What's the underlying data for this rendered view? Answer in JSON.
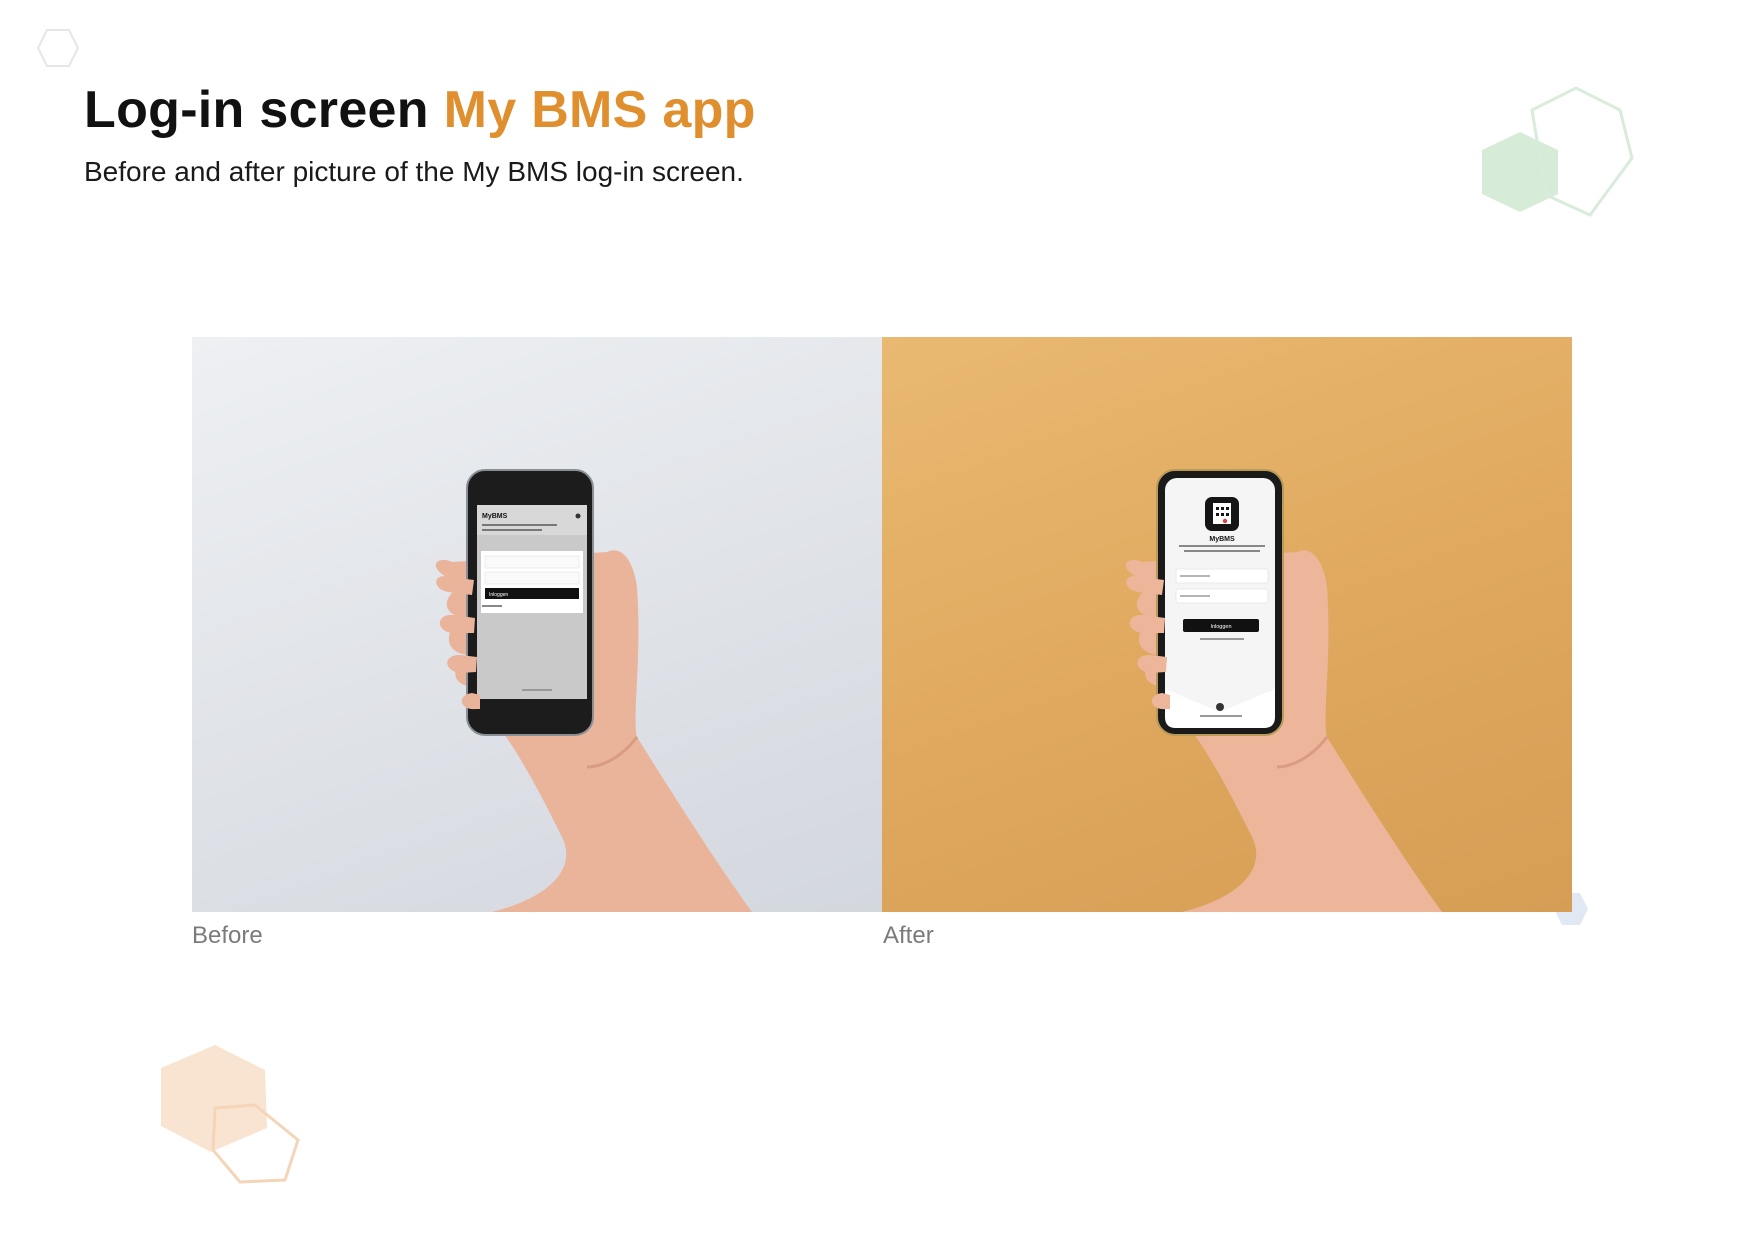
{
  "header": {
    "title_main": "Log-in screen",
    "title_accent": "My BMS app",
    "subtitle": "Before and after picture of the My BMS log-in screen."
  },
  "before": {
    "caption": "Before",
    "app_name": "MyBMS",
    "button_label": "Inloggen"
  },
  "after": {
    "caption": "After",
    "app_name": "MyBMS",
    "button_label": "Inloggen"
  },
  "colors": {
    "accent": "#e08f2e",
    "after_background": "#e0a95f",
    "before_background": "#dfe2e7",
    "hex_green": "#cfe8d3",
    "hex_peach": "#f6dcc4",
    "hex_blue": "#dbe5f1"
  },
  "icons": {
    "app_icon": "building-icon"
  }
}
